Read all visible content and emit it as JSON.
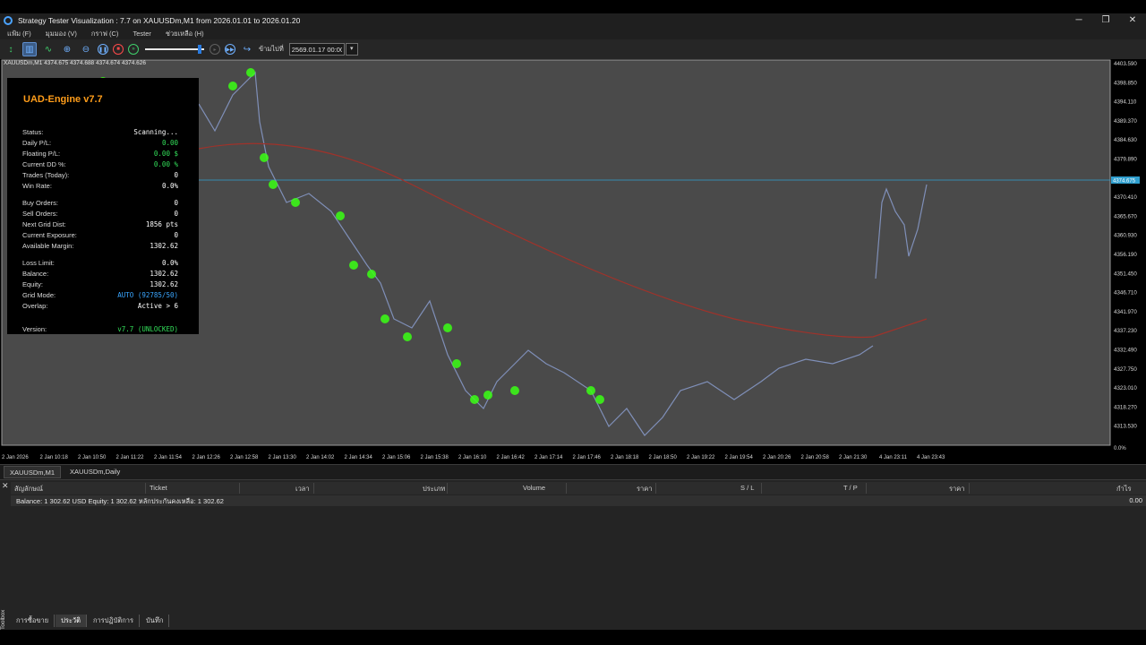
{
  "window": {
    "title": "Strategy Tester Visualization : 7.7 on XAUUSDm,M1 from 2026.01.01 to 2026.01.20",
    "buttons": [
      "─",
      "❐",
      "✕"
    ]
  },
  "menu": [
    "แฟ้ม (F)",
    "มุมมอง (V)",
    "กราฟ (C)",
    "Tester",
    "ช่วยเหลือ (H)"
  ],
  "toolbar": {
    "skip_label": "ข้ามไปที่",
    "date_value": "2569.01.17 00:00",
    "speed_fraction": 0.95
  },
  "chart": {
    "header": "XAUUSDm,M1  4374.675 4374.688 4374.674 4374.626",
    "price_labels": [
      "4403.590",
      "4398.850",
      "4394.110",
      "4389.370",
      "4384.630",
      "4379.890",
      "4370.410",
      "4365.670",
      "4360.930",
      "4356.190",
      "4351.450",
      "4346.710",
      "4341.970",
      "4337.230",
      "4332.490",
      "4327.750",
      "4323.010",
      "4318.270",
      "4313.530"
    ],
    "current_price_label": "4374.675",
    "indicator_label": "0.0%",
    "time_labels": [
      "2 Jan 2026",
      "2 Jan 10:18",
      "2 Jan 10:50",
      "2 Jan 11:22",
      "2 Jan 11:54",
      "2 Jan 12:26",
      "2 Jan 12:58",
      "2 Jan 13:30",
      "2 Jan 14:02",
      "2 Jan 14:34",
      "2 Jan 15:06",
      "2 Jan 15:38",
      "2 Jan 16:10",
      "2 Jan 16:42",
      "2 Jan 17:14",
      "2 Jan 17:46",
      "2 Jan 18:18",
      "2 Jan 18:50",
      "2 Jan 19:22",
      "2 Jan 19:54",
      "2 Jan 20:26",
      "2 Jan 20:58",
      "2 Jan 21:30",
      "4 Jan 23:11",
      "4 Jan 23:43"
    ]
  },
  "panel": {
    "title": "UAD-Engine v7.7",
    "rows": [
      {
        "label": "Status:",
        "value": "Scanning...",
        "color": "#ffffff"
      },
      {
        "label": "Daily P/L:",
        "value": "0.00",
        "color": "#33e05a"
      },
      {
        "label": "Floating P/L:",
        "value": "0.00 $",
        "color": "#33e05a"
      },
      {
        "label": "Current DD %:",
        "value": "0.00 %",
        "color": "#33e05a"
      },
      {
        "label": "Trades (Today):",
        "value": "0",
        "color": "#ffffff"
      },
      {
        "label": "Win Rate:",
        "value": "0.0%",
        "color": "#ffffff"
      },
      {
        "label": "Buy Orders:",
        "value": "0",
        "color": "#ffffff"
      },
      {
        "label": "Sell Orders:",
        "value": "0",
        "color": "#ffffff"
      },
      {
        "label": "Next Grid Dist:",
        "value": "1856 pts",
        "color": "#ffffff"
      },
      {
        "label": "Current Exposure:",
        "value": "0",
        "color": "#ffffff"
      },
      {
        "label": "Available Margin:",
        "value": "1302.62",
        "color": "#ffffff"
      },
      {
        "label": "Loss Limit:",
        "value": "0.0%",
        "color": "#ffffff"
      },
      {
        "label": "Balance:",
        "value": "1302.62",
        "color": "#ffffff"
      },
      {
        "label": "Equity:",
        "value": "1302.62",
        "color": "#ffffff"
      },
      {
        "label": "Grid Mode:",
        "value": "AUTO (92785/50)",
        "color": "#3aa6ff"
      },
      {
        "label": "Overlap:",
        "value": "Active > 6",
        "color": "#ffffff"
      },
      {
        "label": "Version:",
        "value": "v7.7 (UNLOCKED)",
        "color": "#33e05a"
      }
    ]
  },
  "chart_tabs": [
    "XAUUSDm,M1",
    "XAUUSDm,Daily"
  ],
  "terminal": {
    "columns": [
      "สัญลักษณ์",
      "Ticket",
      "เวลา",
      "ประเภท",
      "Volume",
      "ราคา",
      "S / L",
      "T / P",
      "ราคา",
      "กำไร"
    ],
    "balance_row": "Balance: 1 302.62 USD  Equity: 1 302.62  หลักประกันคงเหลือ: 1 302.62",
    "balance_profit": "0.00",
    "toolbox_label": "Toolbox",
    "tabs": [
      "การซื้อขาย",
      "ประวัติ",
      "การปฏิบัติการ",
      "บันทึก"
    ]
  },
  "colors": {
    "bg": "#4a4a4a",
    "price_line": "#7f8fb8",
    "ma_line": "#a0322a",
    "current_line": "#2f9fcf",
    "marker_green": "#39ff14"
  }
}
